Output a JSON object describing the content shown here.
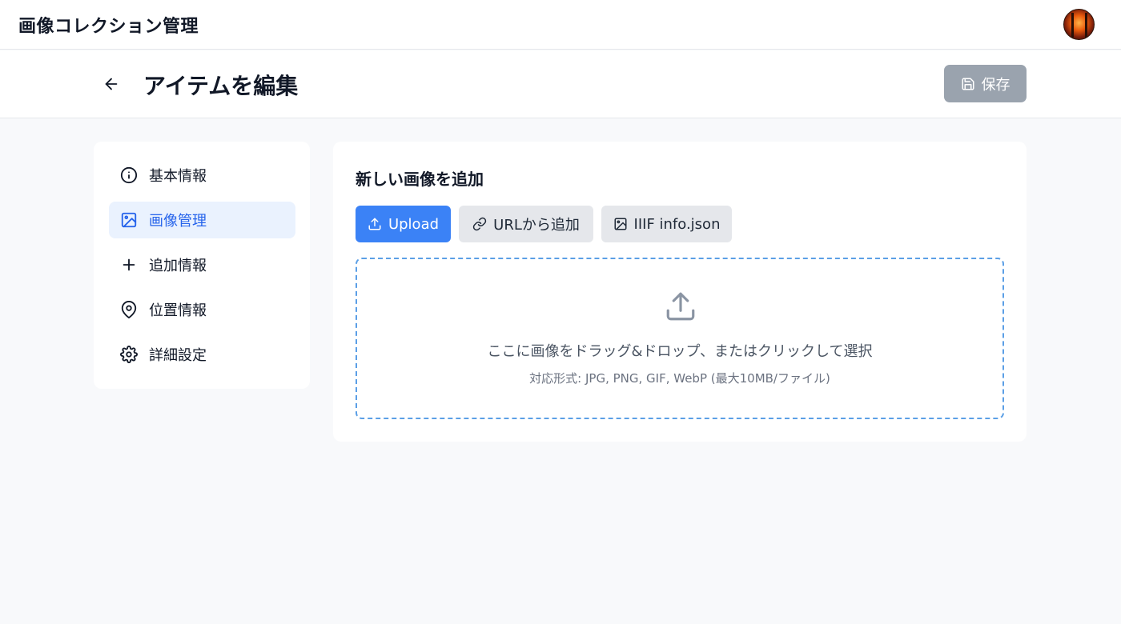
{
  "app": {
    "title": "画像コレクション管理"
  },
  "header": {
    "title": "アイテムを編集",
    "save_label": "保存"
  },
  "sidebar": {
    "items": [
      {
        "label": "基本情報",
        "icon": "info-icon",
        "active": false
      },
      {
        "label": "画像管理",
        "icon": "image-icon",
        "active": true
      },
      {
        "label": "追加情報",
        "icon": "plus-icon",
        "active": false
      },
      {
        "label": "位置情報",
        "icon": "map-pin-icon",
        "active": false
      },
      {
        "label": "詳細設定",
        "icon": "gear-icon",
        "active": false
      }
    ]
  },
  "panel": {
    "title": "新しい画像を追加",
    "tabs": [
      {
        "label": "Upload",
        "icon": "upload-icon",
        "active": true
      },
      {
        "label": "URLから追加",
        "icon": "link-icon",
        "active": false
      },
      {
        "label": "IIIF info.json",
        "icon": "image-icon",
        "active": false
      }
    ],
    "dropzone": {
      "main_text": "ここに画像をドラッグ&ドロップ、またはクリックして選択",
      "sub_text": "対応形式: JPG, PNG, GIF, WebP (最大10MB/ファイル)"
    }
  },
  "colors": {
    "accent": "#3b82f6",
    "active_bg": "#eaf2fe",
    "active_text": "#2563eb",
    "save_disabled": "#9aa3ae",
    "dropzone_border": "#5b9fe6"
  }
}
